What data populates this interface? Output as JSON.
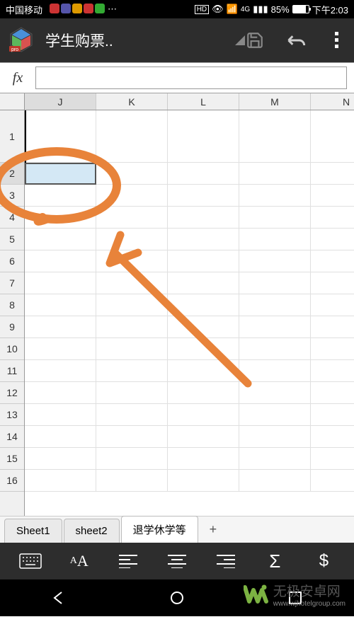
{
  "status": {
    "carrier": "中国移动",
    "hd_label": "HD",
    "network": "4G",
    "battery_pct": "85%",
    "time": "下午2:03"
  },
  "appbar": {
    "title": "学生购票.."
  },
  "fx": {
    "label": "fx",
    "value": ""
  },
  "grid": {
    "columns": [
      "J",
      "K",
      "L",
      "M",
      "N"
    ],
    "rows": [
      "1",
      "2",
      "3",
      "4",
      "5",
      "6",
      "7",
      "8",
      "9",
      "10",
      "11",
      "12",
      "13",
      "14",
      "15",
      "16"
    ],
    "selected_col": "J",
    "selected_row": "2"
  },
  "sheets": {
    "tabs": [
      {
        "label": "Sheet1",
        "active": false
      },
      {
        "label": "sheet2",
        "active": false
      },
      {
        "label": "退学休学等",
        "active": true
      }
    ],
    "add": "+"
  },
  "toolbar": {
    "sum": "Σ",
    "currency": "$"
  },
  "watermark": {
    "text": "无极安卓网",
    "sub": "www.wjhotelgroup.com"
  }
}
